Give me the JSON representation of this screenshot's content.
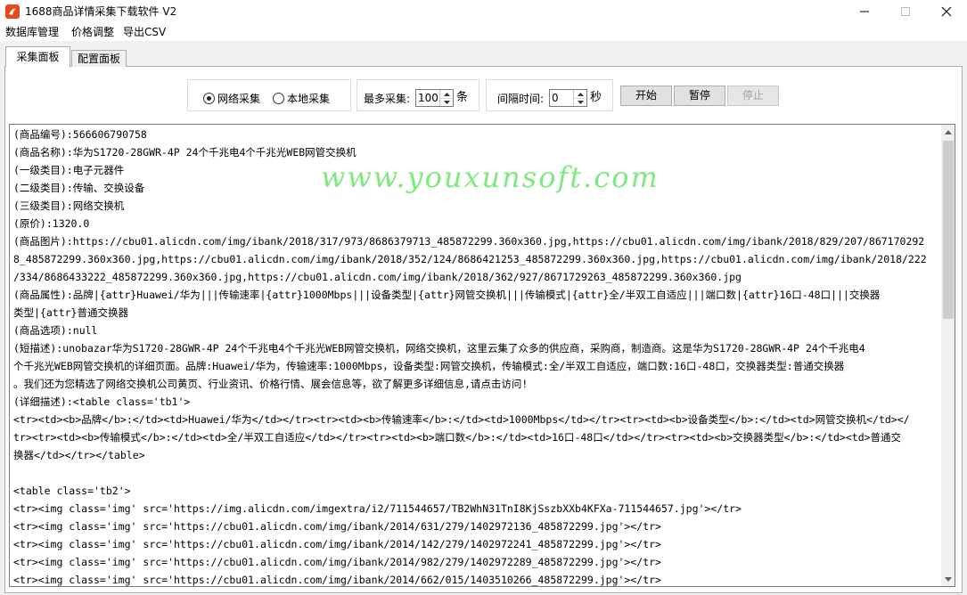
{
  "window": {
    "title": "1688商品详情采集下载软件 V2"
  },
  "menu": {
    "items": [
      "数据库管理",
      "价格调整",
      "导出CSV"
    ]
  },
  "tabs": {
    "active": "采集面板",
    "inactive": "配置面板"
  },
  "controls": {
    "radio_network": "网络采集",
    "radio_local": "本地采集",
    "selected_mode": "网络采集",
    "max_label": "最多采集:",
    "max_value": "100",
    "max_unit": "条",
    "interval_label": "间隔时间:",
    "interval_value": "0",
    "interval_unit": "秒",
    "start_label": "开始",
    "pause_label": "暂停",
    "stop_label": "停止"
  },
  "output": {
    "lines": [
      "(商品编号):566606790758",
      "(商品名称):华为S1720-28GWR-4P 24个千兆电4个千兆光WEB网管交换机",
      "(一级类目):电子元器件",
      "(二级类目):传输、交换设备",
      "(三级类目):网络交换机",
      "(原价):1320.0",
      "(商品图片):https://cbu01.alicdn.com/img/ibank/2018/317/973/8686379713_485872299.360x360.jpg,https://cbu01.alicdn.com/img/ibank/2018/829/207/867170292",
      "8_485872299.360x360.jpg,https://cbu01.alicdn.com/img/ibank/2018/352/124/8686421253_485872299.360x360.jpg,https://cbu01.alicdn.com/img/ibank/2018/222",
      "/334/8686433222_485872299.360x360.jpg,https://cbu01.alicdn.com/img/ibank/2018/362/927/8671729263_485872299.360x360.jpg",
      "(商品属性):品牌|{attr}Huawei/华为|||传输速率|{attr}1000Mbps|||设备类型|{attr}网管交换机|||传输模式|{attr}全/半双工自适应|||端口数|{attr}16口-48口|||交换器",
      "类型|{attr}普通交换器",
      "(商品选项):null",
      "(短描述):unobazar华为S1720-28GWR-4P 24个千兆电4个千兆光WEB网管交换机，网络交换机，这里云集了众多的供应商，采购商，制造商。这是华为S1720-28GWR-4P 24个千兆电4",
      "个千兆光WEB网管交换机的详细页面。品牌:Huawei/华为，传输速率:1000Mbps，设备类型:网管交换机，传输模式:全/半双工自适应，端口数:16口-48口，交换器类型:普通交换器",
      "。我们还为您精选了网络交换机公司黄页、行业资讯、价格行情、展会信息等，欲了解更多详细信息,请点击访问!",
      "(详细描述):<table  class='tb1'>",
      "<tr><td><b>品牌</b>:</td><td>Huawei/华为</td></tr><tr><td><b>传输速率</b>:</td><td>1000Mbps</td></tr><tr><td><b>设备类型</b>:</td><td>网管交换机</td></",
      "tr><tr><td><b>传输模式</b>:</td><td>全/半双工自适应</td></tr><tr><td><b>端口数</b>:</td><td>16口-48口</td></tr><tr><td><b>交换器类型</b>:</td><td>普通交",
      "换器</td></tr></table>",
      "",
      "<table  class='tb2'>",
      "<tr><img class='img'  src='https://img.alicdn.com/imgextra/i2/711544657/TB2WhN31TnI8KjSszbXXb4KFXa-711544657.jpg'></tr>",
      "<tr><img class='img'  src='https://cbu01.alicdn.com/img/ibank/2014/631/279/1402972136_485872299.jpg'></tr>",
      "<tr><img class='img'  src='https://cbu01.alicdn.com/img/ibank/2014/142/279/1402972241_485872299.jpg'></tr>",
      "<tr><img class='img'  src='https://cbu01.alicdn.com/img/ibank/2014/982/279/1402972289_485872299.jpg'></tr>",
      "<tr><img class='img'  src='https://cbu01.alicdn.com/img/ibank/2014/662/015/1403510266_485872299.jpg'></tr>"
    ]
  },
  "watermark": "www.youxunsoft.com",
  "icons": {
    "app": "app-logo-icon",
    "minimize": "minimize-icon",
    "maximize": "maximize-icon",
    "close": "close-icon"
  },
  "colors": {
    "app_icon": "#e8481a",
    "watermark": "#46e146"
  }
}
